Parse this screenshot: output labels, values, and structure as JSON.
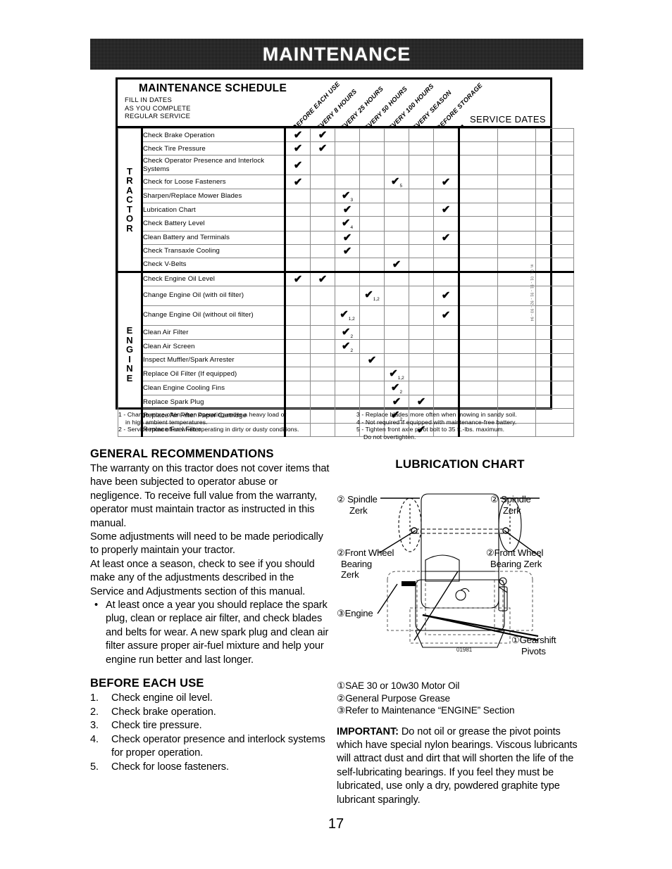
{
  "banner": {
    "title": "MAINTENANCE"
  },
  "page_number": "17",
  "schedule": {
    "title": "MAINTENANCE SCHEDULE",
    "subtitle_lines": [
      "FILL IN DATES",
      "AS YOU COMPLETE",
      "REGULAR SERVICE"
    ],
    "service_dates_label": "SERVICE DATES",
    "side_code": "m. 01. 01 - 91 - 91 - 92 - 93 - 94",
    "columns": [
      "BEFORE EACH USE",
      "EVERY 8 HOURS",
      "EVERY 25 HOURS",
      "EVERY 50 HOURS",
      "EVERY 100 HOURS",
      "EVERY SEASON",
      "BEFORE STORAGE"
    ],
    "groups": [
      {
        "name": "TRACTOR",
        "rows": [
          {
            "task": "Check Brake Operation",
            "marks": [
              "x",
              "x",
              "",
              "",
              "",
              "",
              ""
            ]
          },
          {
            "task": "Check Tire Pressure",
            "marks": [
              "x",
              "x",
              "",
              "",
              "",
              "",
              ""
            ]
          },
          {
            "task": "Check Operator Presence and Interlock Systems",
            "marks": [
              "x",
              "",
              "",
              "",
              "",
              "",
              ""
            ]
          },
          {
            "task": "Check for Loose Fasteners",
            "marks": [
              "x",
              "",
              "",
              "",
              "x5",
              "",
              "x"
            ]
          },
          {
            "task": "Sharpen/Replace Mower Blades",
            "marks": [
              "",
              "",
              "x3",
              "",
              "",
              "",
              ""
            ]
          },
          {
            "task": "Lubrication Chart",
            "marks": [
              "",
              "",
              "x",
              "",
              "",
              "",
              "x"
            ]
          },
          {
            "task": "Check Battery Level",
            "marks": [
              "",
              "",
              "x4",
              "",
              "",
              "",
              ""
            ]
          },
          {
            "task": "Clean Battery and Terminals",
            "marks": [
              "",
              "",
              "x",
              "",
              "",
              "",
              "x"
            ]
          },
          {
            "task": "Check Transaxle Cooling",
            "marks": [
              "",
              "",
              "x",
              "",
              "",
              "",
              ""
            ]
          },
          {
            "task": "Check V-Belts",
            "marks": [
              "",
              "",
              "",
              "",
              "x",
              "",
              ""
            ]
          }
        ]
      },
      {
        "name": "ENGINE",
        "rows": [
          {
            "task": "Check Engine Oil Level",
            "marks": [
              "x",
              "x",
              "",
              "",
              "",
              "",
              ""
            ]
          },
          {
            "task": "Change Engine Oil (with oil filter)",
            "marks": [
              "",
              "",
              "",
              "x1,2",
              "",
              "",
              "x"
            ]
          },
          {
            "task": "Change Engine Oil (without oil filter)",
            "marks": [
              "",
              "",
              "x1,2",
              "",
              "",
              "",
              "x"
            ]
          },
          {
            "task": "Clean Air Filter",
            "marks": [
              "",
              "",
              "x2",
              "",
              "",
              "",
              ""
            ]
          },
          {
            "task": "Clean Air Screen",
            "marks": [
              "",
              "",
              "x2",
              "",
              "",
              "",
              ""
            ]
          },
          {
            "task": "Inspect Muffler/Spark Arrester",
            "marks": [
              "",
              "",
              "",
              "x",
              "",
              "",
              ""
            ]
          },
          {
            "task": "Replace Oil Filter (If equipped)",
            "marks": [
              "",
              "",
              "",
              "",
              "x1,2",
              "",
              ""
            ]
          },
          {
            "task": "Clean Engine Cooling Fins",
            "marks": [
              "",
              "",
              "",
              "",
              "x2",
              "",
              ""
            ]
          },
          {
            "task": "Replace Spark Plug",
            "marks": [
              "",
              "",
              "",
              "",
              "x",
              "x",
              ""
            ]
          },
          {
            "task": "Replace Air Filter Paper Cartridge",
            "marks": [
              "",
              "",
              "",
              "",
              "x2",
              "",
              ""
            ]
          },
          {
            "task": "Replace Fuel Filter",
            "marks": [
              "",
              "",
              "",
              "",
              "",
              "x",
              ""
            ]
          }
        ]
      }
    ],
    "footnotes_left": [
      "1 - Change more often when operating under a heavy load or",
      "in high ambient temperatures.",
      "2 - Service more often when operating in dirty or dusty conditions."
    ],
    "footnotes_right": [
      "3 - Replace blades more often when mowing in sandy soil.",
      "4 - Not required if equipped with maintenance-free battery.",
      "5 - Tighten front axle pivot bolt to 35 ft.-lbs. maximum.",
      "Do not overtighten."
    ]
  },
  "general": {
    "heading": "GENERAL RECOMMENDATIONS",
    "para1": "The warranty on this tractor does not cover items that have been subjected to operator abuse or negligence.  To receive full value from the warranty, operator must maintain tractor as instructed in this manual.",
    "para2": "Some adjustments will need to be made periodically to properly maintain your tractor.",
    "para3": "At least once a season, check to see if you should make any of the adjustments described in the Service and Adjustments section of this manual.",
    "bullet1": "At least once a year you should replace the spark plug, clean or replace air filter, and check blades and belts for wear. A new spark plug and clean air filter assure proper air-fuel mixture and help your engine run better and last longer."
  },
  "before_each_use": {
    "heading": "BEFORE EACH USE",
    "steps": [
      {
        "num": "1.",
        "text": "Check engine oil level."
      },
      {
        "num": "2.",
        "text": "Check brake operation."
      },
      {
        "num": "3.",
        "text": "Check tire pressure."
      },
      {
        "num": "4.",
        "text": "Check operator presence and interlock systems for proper operation."
      },
      {
        "num": "5.",
        "text": "Check for loose fasteners."
      }
    ]
  },
  "lubrication": {
    "heading": "LUBRICATION CHART",
    "diagram_code": "01981",
    "callouts": {
      "spindle_left": "② Spindle\n    Zerk",
      "spindle_left_l1": "② Spindle",
      "spindle_left_l2": "Zerk",
      "spindle_right_l1": "② Spindle",
      "spindle_right_l2": "Zerk",
      "front_wheel_left_l1": "②Front Wheel",
      "front_wheel_left_l2": "Bearing",
      "front_wheel_left_l3": "Zerk",
      "front_wheel_right_l1": "②Front Wheel",
      "front_wheel_right_l2": "Bearing Zerk",
      "engine": "③Engine",
      "gearshift_l1": "①Gearshift",
      "gearshift_l2": "Pivots"
    },
    "legend": [
      "①SAE 30 or 10w30 Motor Oil",
      "②General Purpose Grease",
      "③Refer to Maintenance  “ENGINE” Section"
    ],
    "important_label": "IMPORTANT:",
    "important_text": "  Do not oil or grease the pivot points which have special nylon bearings.  Viscous lubricants will attract dust and dirt that will shorten the life of the self-lubricating bearings.  If you feel they must be lubricated, use only a dry, powdered graphite type lubricant sparingly."
  }
}
